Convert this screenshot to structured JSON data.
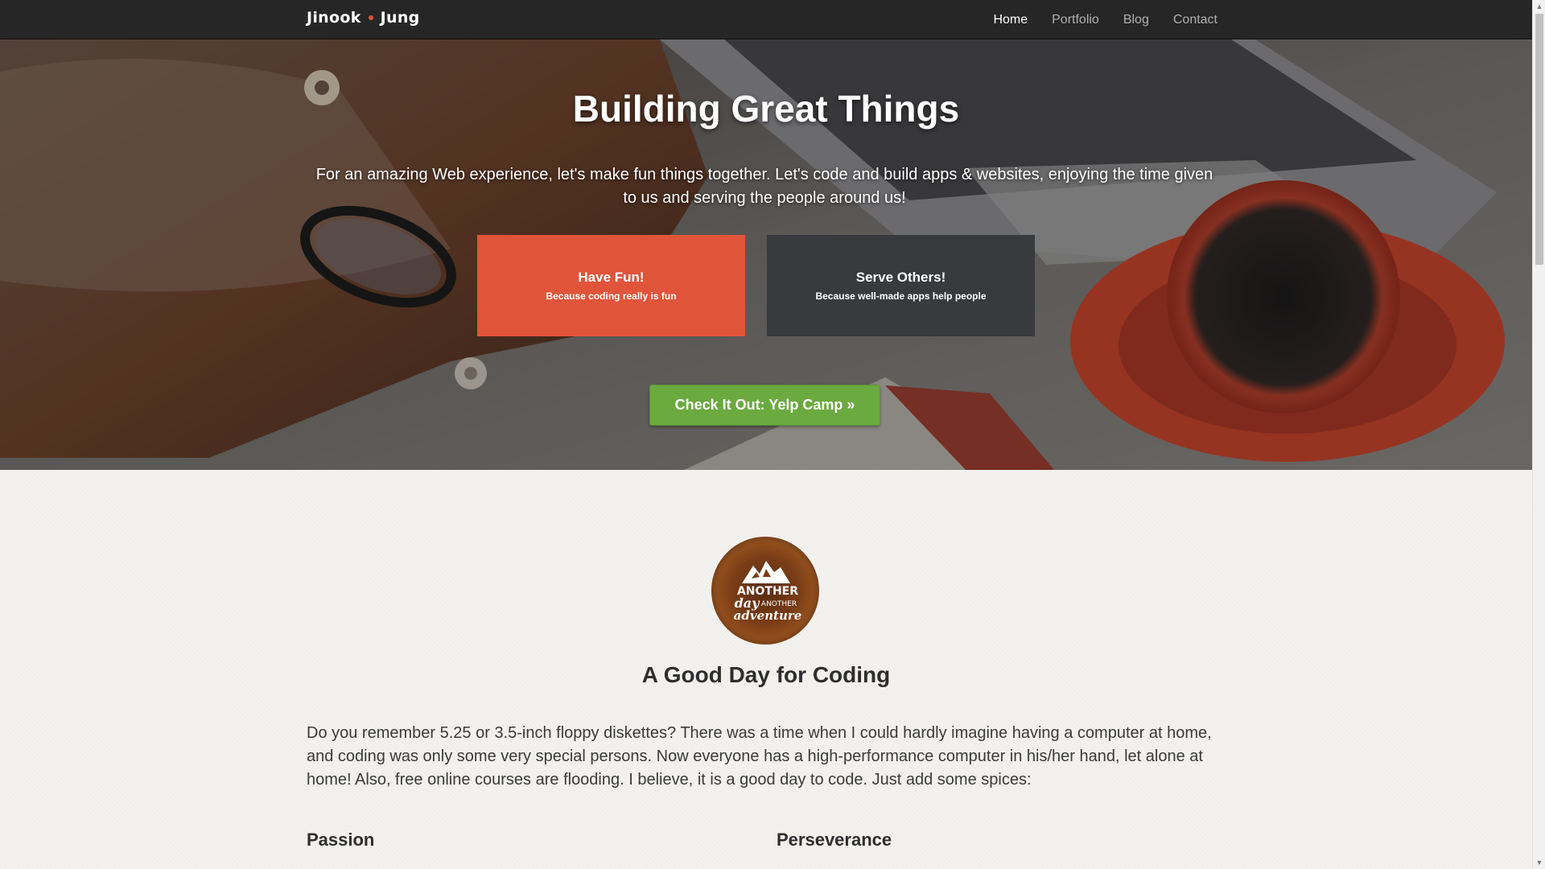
{
  "navbar": {
    "brand_first": "Jinook",
    "brand_last": "Jung",
    "items": [
      {
        "label": "Home",
        "active": true
      },
      {
        "label": "Portfolio",
        "active": false
      },
      {
        "label": "Blog",
        "active": false
      },
      {
        "label": "Contact",
        "active": false
      }
    ]
  },
  "hero": {
    "title": "Building Great Things",
    "subtitle": "For an amazing Web experience, let's make fun things together. Let's code and build apps & websites, enjoying the time given to us and serving the people around us!",
    "cards": [
      {
        "title": "Have Fun!",
        "subtitle": "Because coding really is fun",
        "color": "#e0543a"
      },
      {
        "title": "Serve Others!",
        "subtitle": "Because well-made apps help people",
        "color": "#383a3e"
      }
    ],
    "cta_label": "Check It Out: Yelp Camp »",
    "cta_color": "#6aaa3e"
  },
  "logo": {
    "line1": "ANOTHER",
    "line2": "day",
    "line3": "ANOTHER",
    "line4": "adventure"
  },
  "content": {
    "section_title": "A Good Day for Coding",
    "intro": "Do you remember 5.25 or 3.5-inch floppy diskettes? There was a time when I could hardly imagine having a computer at home, and coding was only some very special persons. Now everyone has a high-performance computer in his/her hand, let alone at home! Also, free online courses are flooding. I believe, it is a good day to code. Just add some spices:",
    "columns": [
      {
        "title": "Passion"
      },
      {
        "title": "Perseverance"
      }
    ]
  },
  "colors": {
    "navbar_bg": "#262626",
    "accent_dot": "#e0513a"
  }
}
